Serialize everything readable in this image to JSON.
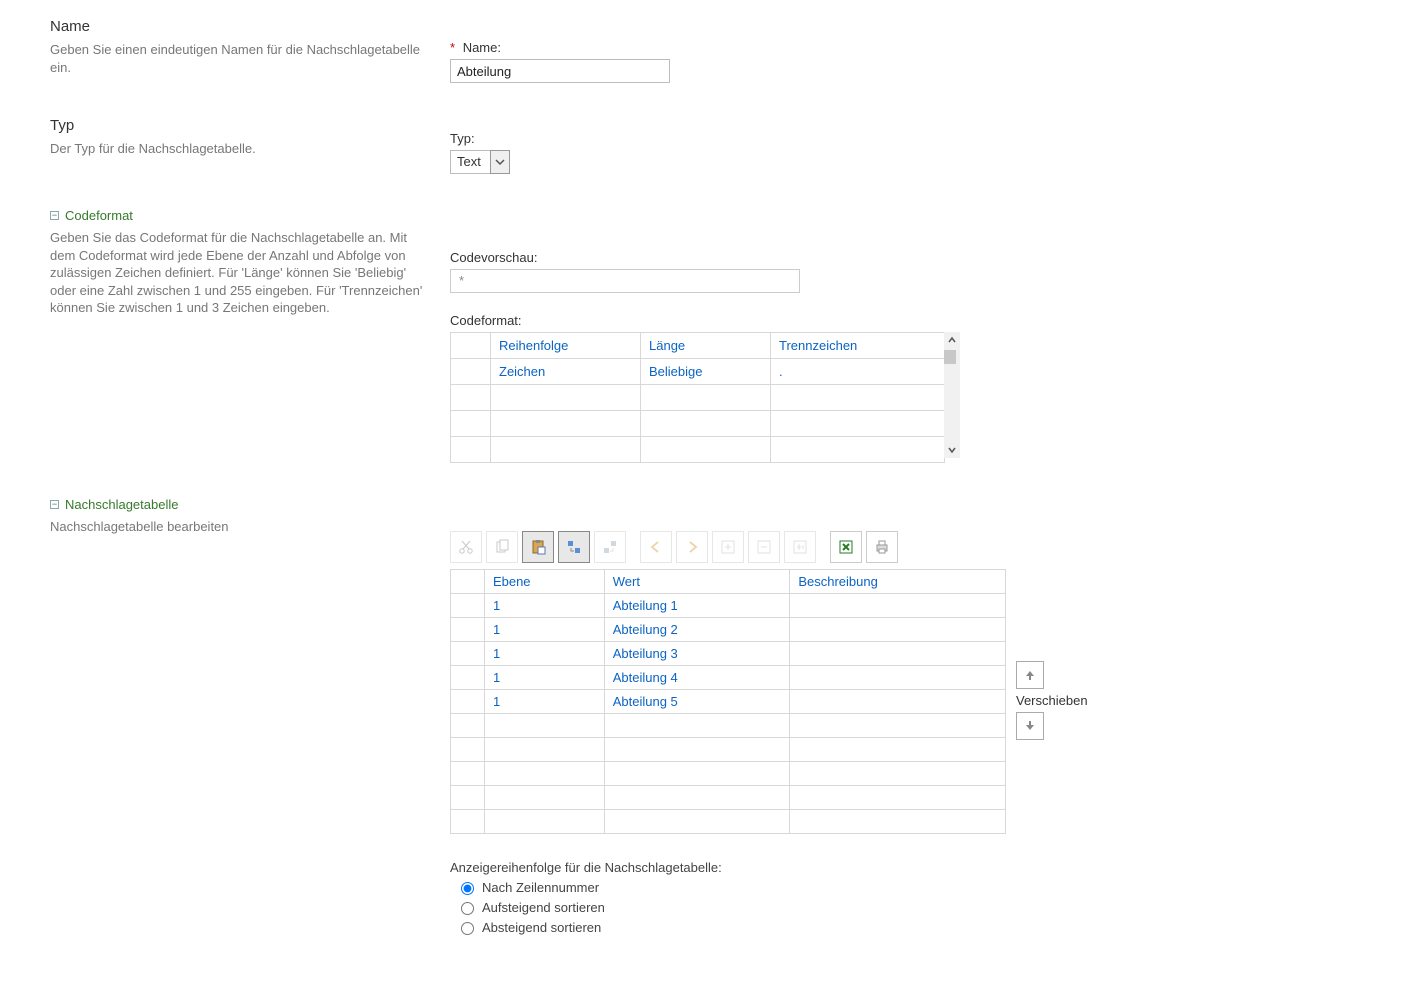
{
  "name_section": {
    "title": "Name",
    "desc": "Geben Sie einen eindeutigen Namen für die Nachschlagetabelle ein.",
    "field_label": "Name:",
    "required_mark": "*",
    "value": "Abteilung"
  },
  "type_section": {
    "title": "Typ",
    "desc": "Der Typ für die Nachschlagetabelle.",
    "field_label": "Typ:",
    "value": "Text"
  },
  "codeformat_section": {
    "title": "Codeformat",
    "desc": "Geben Sie das Codeformat für die Nachschlagetabelle an. Mit dem Codeformat wird jede Ebene der Anzahl und Abfolge von zulässigen Zeichen definiert. Für 'Länge' können Sie 'Beliebig' oder eine Zahl zwischen 1 und 255 eingeben. Für 'Trennzeichen' können Sie zwischen 1 und 3 Zeichen eingeben.",
    "preview_label": "Codevorschau:",
    "preview_value": "*",
    "grid_label": "Codeformat:",
    "headers": {
      "seq": "Reihenfolge",
      "len": "Länge",
      "sep": "Trennzeichen"
    },
    "row0": {
      "seq": "Zeichen",
      "len": "Beliebige",
      "sep": "."
    }
  },
  "lookup_section": {
    "title": "Nachschlagetabelle",
    "desc": "Nachschlagetabelle bearbeiten",
    "headers": {
      "level": "Ebene",
      "value": "Wert",
      "desc": "Beschreibung"
    },
    "rows": {
      "0": {
        "level": "1",
        "value": "Abteilung 1",
        "desc": ""
      },
      "1": {
        "level": "1",
        "value": "Abteilung 2",
        "desc": ""
      },
      "2": {
        "level": "1",
        "value": "Abteilung 3",
        "desc": ""
      },
      "3": {
        "level": "1",
        "value": "Abteilung 4",
        "desc": ""
      },
      "4": {
        "level": "1",
        "value": "Abteilung 5",
        "desc": ""
      }
    },
    "move_label": "Verschieben"
  },
  "sort_section": {
    "label": "Anzeigereihenfolge für die Nachschlagetabelle:",
    "opt0": "Nach Zeilennummer",
    "opt1": "Aufsteigend sortieren",
    "opt2": "Absteigend sortieren"
  },
  "toolbar": {
    "cut": "cut",
    "copy": "copy",
    "paste": "paste",
    "indent": "indent",
    "outdent": "outdent",
    "left": "prev",
    "right": "next",
    "add": "add",
    "remove": "remove",
    "addspecial": "add-special",
    "excel": "export-excel",
    "print": "print"
  }
}
